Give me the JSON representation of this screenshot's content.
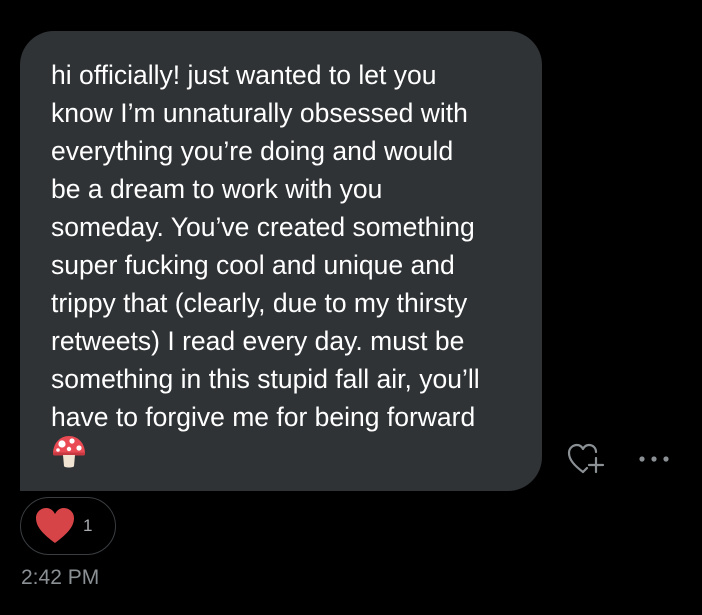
{
  "message": {
    "lines": [
      "hi officially! just wanted to let you",
      "know I’m unnaturally obsessed with",
      "everything you’re doing and would",
      "be a dream to work with you",
      "someday. You’ve created something",
      "super fucking cool and unique and",
      "trippy that (clearly, due to my thirsty",
      "retweets) I read every day. must be",
      "something in this stupid fall air, you’ll",
      "have to forgive me for being forward"
    ],
    "emoji": "mushroom-emoji"
  },
  "actions": {
    "react_icon": "heart-plus-icon",
    "more_icon": "more-horizontal-icon"
  },
  "reaction": {
    "icon": "red-heart-icon",
    "count": "1"
  },
  "timestamp": "2:42 PM",
  "colors": {
    "background": "#000000",
    "bubble": "#2f3336",
    "text": "#ffffff",
    "muted": "#8b9094",
    "heart": "#d64448"
  }
}
